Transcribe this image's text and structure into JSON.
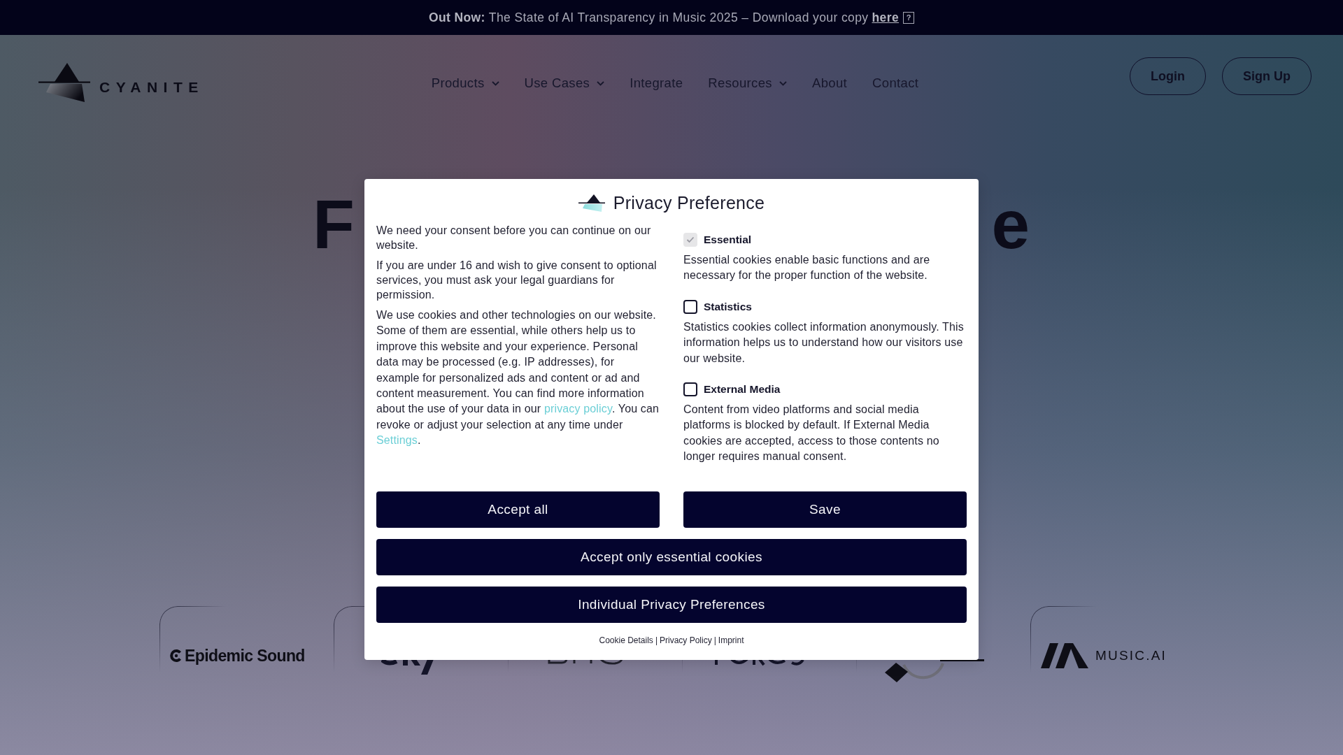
{
  "announcement_bar": {
    "text": "**Out Now:** The State of AI Transparency in Music 2025 – Download your copy",
    "link": "here",
    "icon": "?"
  },
  "header": {
    "logo": "CYANITE",
    "nav": [
      {
        "label": "Products",
        "has_menu": true
      },
      {
        "label": "Use Cases",
        "has_menu": true
      },
      {
        "label": "Integrate",
        "has_menu": false
      },
      {
        "label": "Resources",
        "has_menu": true
      },
      {
        "label": "About",
        "has_menu": false
      },
      {
        "label": "Contact",
        "has_menu": false
      }
    ],
    "buttons": [
      "Login",
      "Sign Up"
    ]
  },
  "hero": {
    "heading_fragments": [
      "F",
      "e"
    ]
  },
  "partner_logos": [
    {
      "kind": "wordmark",
      "text": "Epidemic Sound"
    },
    {
      "kind": "covered"
    },
    {
      "kind": "covered"
    },
    {
      "kind": "covered"
    },
    {
      "kind": "covered"
    },
    {
      "kind": "wordmark",
      "text": "MUSIC.AI"
    }
  ],
  "consent_dialog": {
    "title": "Privacy Preference",
    "paragraphs": [
      [
        {
          "kind": "text",
          "text": "We need your consent before you can continue on our website."
        }
      ],
      [
        {
          "kind": "text",
          "text": "If you are under 16 and wish to give consent to optional services, you must ask your legal guardians for permission."
        }
      ],
      [
        {
          "kind": "text",
          "text": "We use cookies and other technologies on our website. Some of them are essential, while others help us to improve this website and your experience. Personal data may be processed (e.g. IP addresses), for example for personalized ads and content or ad and content measurement. You can find more information about the use of your data in our "
        },
        {
          "kind": "link",
          "text": "privacy policy"
        },
        {
          "kind": "text",
          "text": ". You can revoke or adjust your selection at any time under "
        },
        {
          "kind": "link",
          "text": "Settings"
        },
        {
          "kind": "text",
          "text": "."
        }
      ]
    ],
    "categories": [
      {
        "label": "Essential",
        "checked": true,
        "disabled": true,
        "description": "Essential cookies enable basic functions and are necessary for the proper function of the website."
      },
      {
        "label": "Statistics",
        "checked": false,
        "disabled": false,
        "description": "Statistics cookies collect information anonymously. This information helps us to understand how our visitors use our website."
      },
      {
        "label": "External Media",
        "checked": false,
        "disabled": false,
        "description": "Content from video platforms and social media platforms is blocked by default. If External Media cookies are accepted, access to those contents no longer requires manual consent."
      }
    ],
    "button_rows": [
      [
        "Accept all",
        "Save"
      ],
      [
        "Accept only essential cookies"
      ],
      [
        "Individual Privacy Preferences"
      ]
    ],
    "footer_links": [
      "Cookie Details",
      "Privacy Policy",
      "Imprint"
    ],
    "separator": "|"
  }
}
